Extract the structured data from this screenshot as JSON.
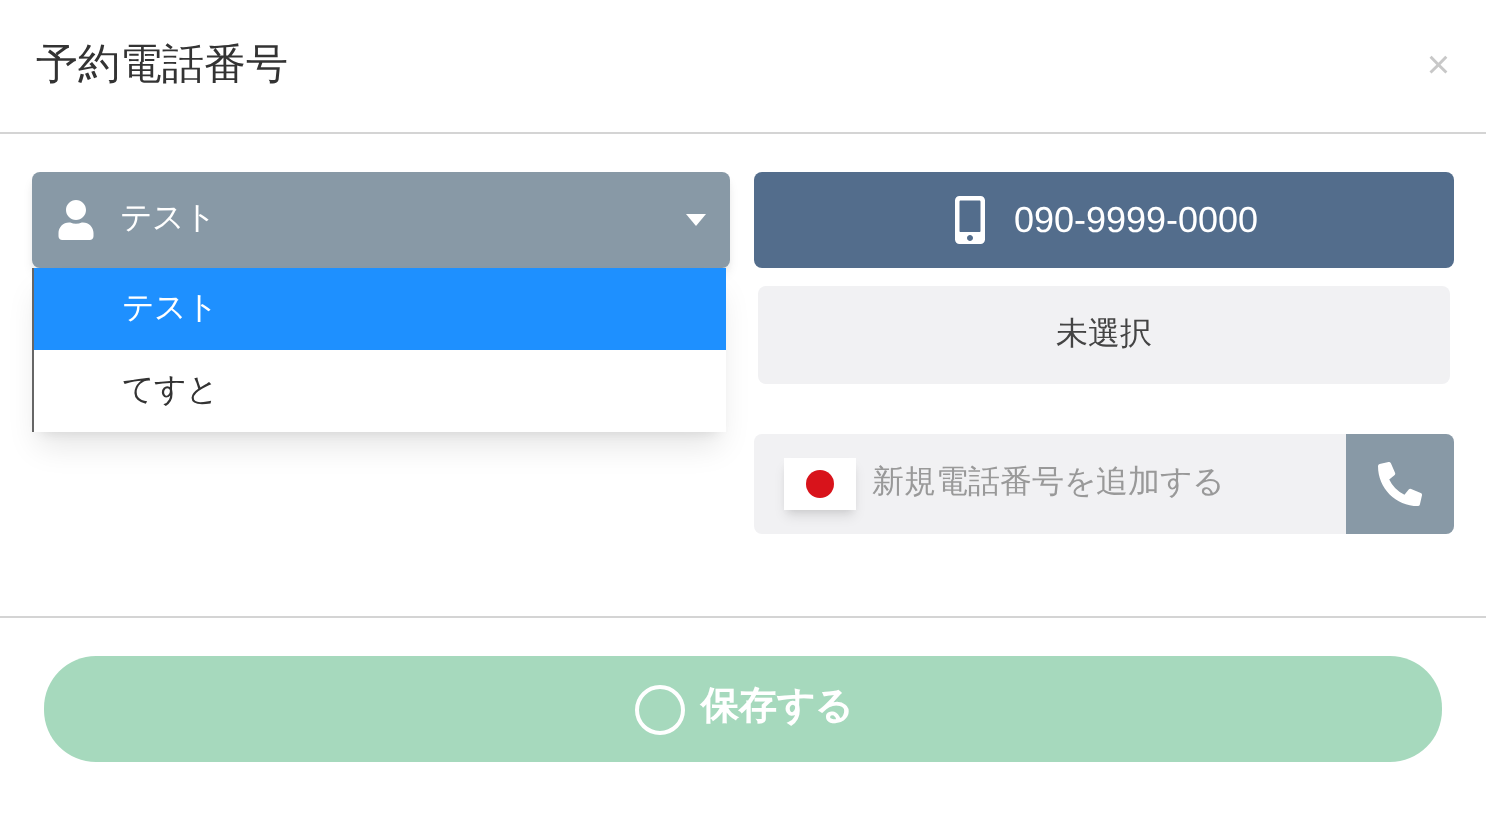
{
  "dialog": {
    "title": "予約電話番号",
    "close": "×"
  },
  "contact_select": {
    "value": "テスト",
    "expanded": true,
    "options": [
      {
        "label": "テスト",
        "selected": true
      },
      {
        "label": "てすと",
        "selected": false
      }
    ]
  },
  "phone_button": {
    "label": "090-9999-0000"
  },
  "unselected_button": {
    "label": "未選択"
  },
  "new_phone": {
    "placeholder": "新規電話番号を追加する"
  },
  "save_button": {
    "label": "保存する",
    "disabled": true
  }
}
